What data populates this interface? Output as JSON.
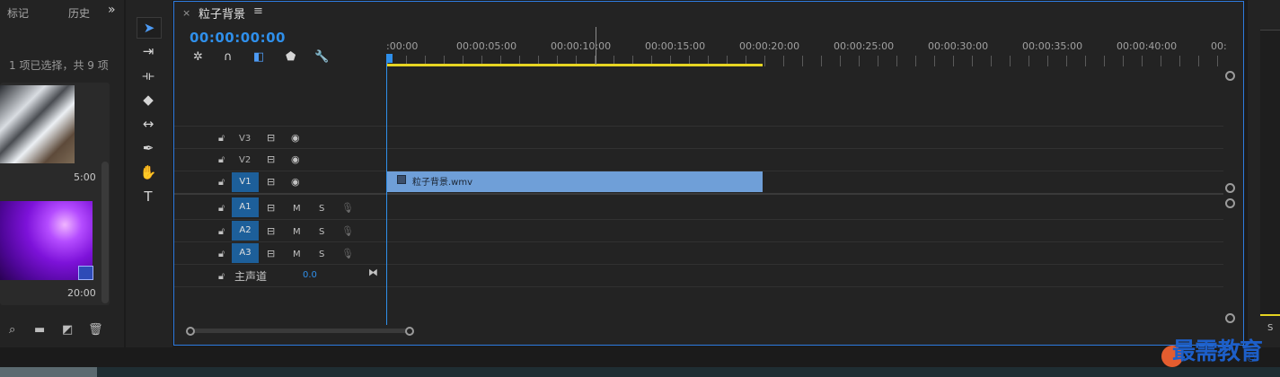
{
  "project_panel": {
    "tabs": [
      "标记",
      "历史"
    ],
    "expand_glyph": "»",
    "selection_info": "1 项已选择，共 9 项",
    "items": [
      {
        "duration": "5:00"
      },
      {
        "duration": "20:00"
      }
    ],
    "toolbar_icons": [
      "search-icon",
      "folder-icon",
      "new-item-icon",
      "trash-icon"
    ]
  },
  "tools": [
    "selection-tool",
    "track-select-tool",
    "ripple-edit-tool",
    "razor-tool",
    "slip-tool",
    "pen-tool",
    "hand-tool",
    "type-tool"
  ],
  "timeline": {
    "close_label": "×",
    "sequence_title": "粒子背景",
    "menu_glyph": "≡",
    "timecode": "00:00:00:00",
    "ruler_labels": [
      ":00:00",
      "00:00:05:00",
      "00:00:10:00",
      "00:00:15:00",
      "00:00:20:00",
      "00:00:25:00",
      "00:00:30:00",
      "00:00:35:00",
      "00:00:40:00",
      "00:"
    ],
    "video_tracks": [
      {
        "name": "V3",
        "targeted": false
      },
      {
        "name": "V2",
        "targeted": false
      },
      {
        "name": "V1",
        "targeted": true
      }
    ],
    "audio_tracks": [
      {
        "name": "A1",
        "m": "M",
        "s": "S"
      },
      {
        "name": "A2",
        "m": "M",
        "s": "S"
      },
      {
        "name": "A3",
        "m": "M",
        "s": "S"
      }
    ],
    "master": {
      "label": "主声道",
      "value": "0.0"
    },
    "clip": {
      "name": "粒子背景.wmv"
    }
  },
  "right_panel": {
    "label": "S"
  },
  "watermark": {
    "text": "最需教育",
    "mark": "©"
  },
  "colors": {
    "accent": "#2f8fea",
    "clip": "#6f9fd8",
    "workarea": "#e6d422"
  }
}
